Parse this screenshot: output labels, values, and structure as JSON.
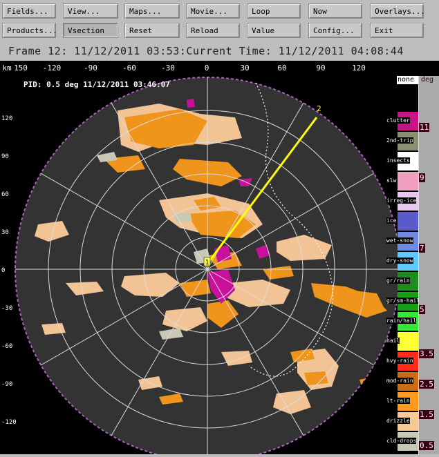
{
  "toolbar": {
    "row1": [
      "Fields...",
      "View...",
      "Maps...",
      "Movie...",
      "Loop",
      "Now",
      "Overlays..."
    ],
    "row2": [
      "Products...",
      "Vsection",
      "Reset",
      "Reload",
      "Value",
      "Config...",
      "Exit"
    ]
  },
  "header": {
    "title": "Frame 12: 11/12/2011 03:53:Current Time: 11/12/2011 04:08:44"
  },
  "plot": {
    "xaxis_unit": "km",
    "xaxis_ticks": [
      "150",
      "-120",
      "-90",
      "-60",
      "-30",
      "0",
      "30",
      "60",
      "90",
      "120"
    ],
    "yaxis_ticks": [
      "120",
      "90",
      "60",
      "30",
      "0",
      "-30",
      "-60",
      "-90",
      "-120"
    ],
    "field_label": "PID: 0.5 deg 11/12/2011 03:46:07",
    "vsection_points": [
      "1",
      "2"
    ]
  },
  "legend": {
    "header_left": "none",
    "header_right": "deg",
    "categories": [
      {
        "label": "clutter",
        "color": "#c71585"
      },
      {
        "label": "2nd-trip",
        "color": "#8e8e73"
      },
      {
        "label": "insects",
        "color": "#ffffff"
      },
      {
        "label": "slw",
        "color": "#f2a0c0"
      },
      {
        "label": "irreg-ice",
        "color": "#e8c8f0"
      },
      {
        "label": "ice",
        "color": "#5a5acd"
      },
      {
        "label": "wet-snow",
        "color": "#6f8ae0"
      },
      {
        "label": "dry-snow",
        "color": "#5fc8ff"
      },
      {
        "label": "gr/rain",
        "color": "#1e8c1e"
      },
      {
        "label": "gr/sm-hail",
        "color": "#16a016"
      },
      {
        "label": "rain/hail",
        "color": "#36e836"
      },
      {
        "label": "hail",
        "color": "#ffff33"
      },
      {
        "label": "hvy-rain",
        "color": "#ff2a1a"
      },
      {
        "label": "mod-rain",
        "color": "#c86e14"
      },
      {
        "label": "lt-rain",
        "color": "#ff9a1a"
      },
      {
        "label": "drizzle",
        "color": "#f5c896"
      },
      {
        "label": "cld-drops",
        "color": "#c8c8b4"
      }
    ],
    "unit_ticks": [
      "11",
      "9",
      "7",
      "5",
      "3.5",
      "2.5",
      "1.5",
      "0.5"
    ]
  }
}
